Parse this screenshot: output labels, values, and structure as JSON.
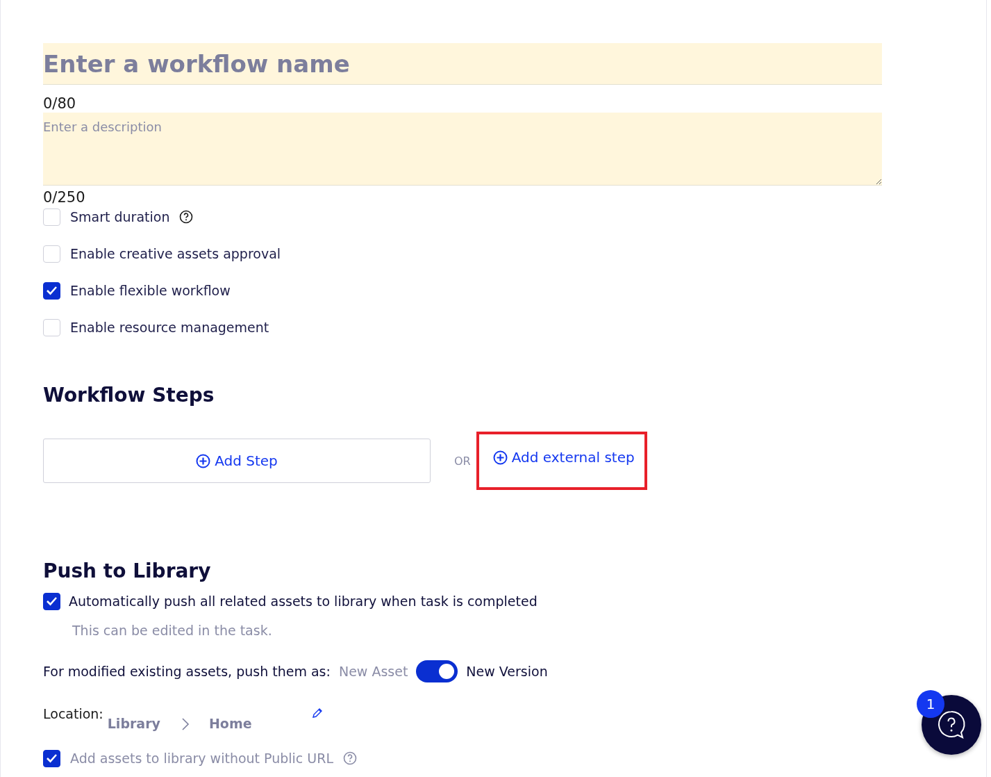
{
  "name_field": {
    "placeholder": "Enter a workflow name",
    "counter": "0/80"
  },
  "description_field": {
    "placeholder": "Enter a description",
    "counter": "0/250"
  },
  "options": [
    {
      "label": "Smart duration",
      "checked": false,
      "help": true
    },
    {
      "label": "Enable creative assets approval",
      "checked": false,
      "help": false
    },
    {
      "label": "Enable flexible workflow",
      "checked": true,
      "help": false
    },
    {
      "label": "Enable resource management",
      "checked": false,
      "help": false
    }
  ],
  "workflow_steps": {
    "title": "Workflow Steps",
    "add_step": "Add Step",
    "separator": "OR",
    "add_external_step": "Add external step",
    "external_highlighted": true
  },
  "push_to_library": {
    "title": "Push to Library",
    "auto_push": {
      "label": "Automatically push all related assets to library when task is completed",
      "checked": true,
      "hint": "This can be edited in the task."
    },
    "push_mode": {
      "label": "For modified existing assets, push them as:",
      "off_label": "New Asset",
      "on_label": "New Version",
      "on": true
    },
    "location": {
      "label": "Location:",
      "path": [
        "Library",
        "Home"
      ]
    },
    "public_url": {
      "label": "Add assets to library without Public URL",
      "checked": true,
      "help": true
    }
  },
  "help_button": {
    "badge": "1"
  }
}
